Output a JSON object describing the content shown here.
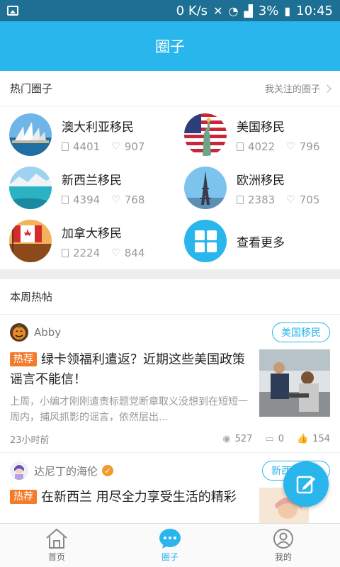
{
  "status_bar": {
    "net_speed": "0 K/s",
    "battery": "3%",
    "time": "10:45"
  },
  "header": {
    "title": "圈子"
  },
  "hot_circles": {
    "title": "热门圈子",
    "link": "我关注的圈子",
    "items": [
      {
        "name": "澳大利亚移民",
        "posts": "4401",
        "likes": "907"
      },
      {
        "name": "美国移民",
        "posts": "4022",
        "likes": "796"
      },
      {
        "name": "新西兰移民",
        "posts": "4394",
        "likes": "768"
      },
      {
        "name": "欧洲移民",
        "posts": "2383",
        "likes": "705"
      },
      {
        "name": "加拿大移民",
        "posts": "2224",
        "likes": "844"
      }
    ],
    "more_label": "查看更多"
  },
  "weekly_posts": {
    "title": "本周热帖",
    "posts": [
      {
        "author": "Abby",
        "tag": "美国移民",
        "hot_label": "热荐",
        "title": "绿卡领福利遣返？近期这些美国政策谣言不能信！",
        "excerpt": "上周，小编才刚刚遣责标题党断章取义没想到在短短一周内，捕风抓影的谣言，依然层出...",
        "time": "23小时前",
        "views": "527",
        "comments": "0",
        "likes": "154"
      },
      {
        "author": "达尼丁的海伦",
        "tag": "新西兰移民",
        "hot_label": "热荐",
        "title": "在新西兰 用尽全力享受生活的精彩"
      }
    ]
  },
  "bottom_nav": {
    "items": [
      {
        "label": "首页"
      },
      {
        "label": "圈子"
      },
      {
        "label": "我的"
      }
    ]
  },
  "colors": {
    "accent": "#29b6ec",
    "hot": "#f37b2b",
    "status_bar": "#1d6f93"
  }
}
